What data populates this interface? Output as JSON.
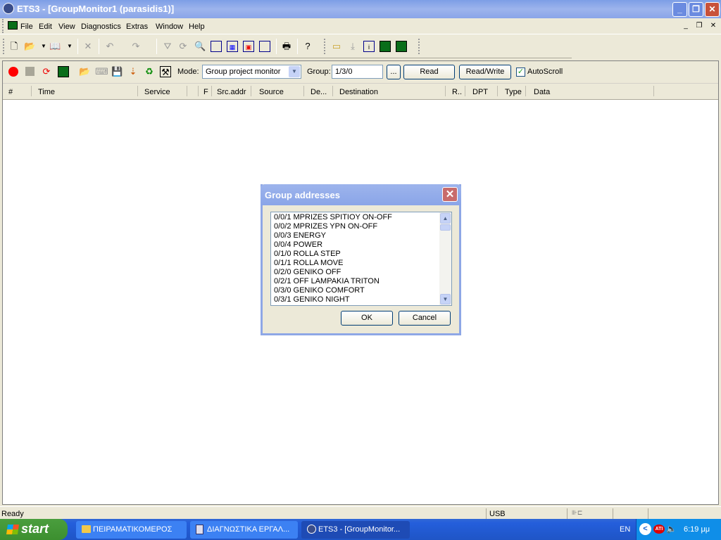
{
  "window": {
    "title": "ETS3 - [GroupMonitor1 (parasidis1)]"
  },
  "menu": [
    "File",
    "Edit",
    "View",
    "Diagnostics",
    "Extras",
    "Window",
    "Help"
  ],
  "monitor_toolbar": {
    "mode_label": "Mode:",
    "mode_value": "Group project monitor",
    "group_label": "Group:",
    "group_value": "1/3/0",
    "browse_label": "...",
    "read_label": "Read",
    "readwrite_label": "Read/Write",
    "autoscroll_label": "AutoScroll",
    "autoscroll_checked": true
  },
  "columns": [
    "#",
    "Time",
    "Service",
    "F",
    "Src.addr",
    "Source",
    "De...",
    "Destination",
    "R..",
    "DPT",
    "Type",
    "Data"
  ],
  "dialog": {
    "title": "Group addresses",
    "items": [
      "0/0/1 MPRIZES SPITIOY ON-OFF",
      "0/0/2 MPRIZES YPN ON-OFF",
      "0/0/3 ENERGY",
      "0/0/4 POWER",
      "0/1/0 ROLLA STEP",
      "0/1/1 ROLLA MOVE",
      "0/2/0 GENIKO OFF",
      "0/2/1 OFF LAMPAKIA TRITON",
      "0/3/0 GENIKO COMFORT",
      "0/3/1 GENIKO NIGHT"
    ],
    "ok_label": "OK",
    "cancel_label": "Cancel"
  },
  "status": {
    "text": "Ready",
    "interface": "USB"
  },
  "taskbar": {
    "start_label": "start",
    "tasks": [
      "ΠΕΙΡΑΜΑΤΙΚΟΜΕΡΟΣ",
      "ΔΙΑΓΝΩΣΤΙΚΑ ΕΡΓΑΛ...",
      "ETS3 - [GroupMonitor..."
    ],
    "lang": "EN",
    "clock": "6:19 μμ"
  }
}
